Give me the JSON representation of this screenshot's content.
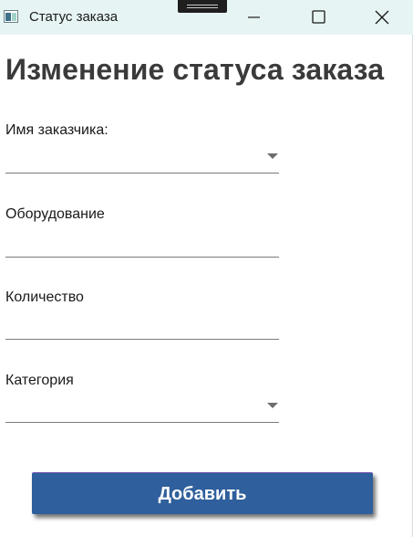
{
  "window": {
    "title": "Статус заказа",
    "controls": {
      "minimize_icon": "minimize-icon",
      "maximize_icon": "maximize-icon",
      "close_icon": "close-icon"
    }
  },
  "form": {
    "heading": "Изменение статуса заказа",
    "fields": [
      {
        "label": "Имя заказчика:",
        "type": "combobox",
        "value": ""
      },
      {
        "label": "Оборудование",
        "type": "textbox",
        "value": ""
      },
      {
        "label": "Количество",
        "type": "textbox",
        "value": ""
      },
      {
        "label": "Категория",
        "type": "combobox",
        "value": ""
      }
    ],
    "submit_label": "Добавить"
  },
  "colors": {
    "titlebar_bg": "#e6f4f3",
    "button_bg": "#2f5f9c",
    "heading_text": "#3a3a3a"
  }
}
